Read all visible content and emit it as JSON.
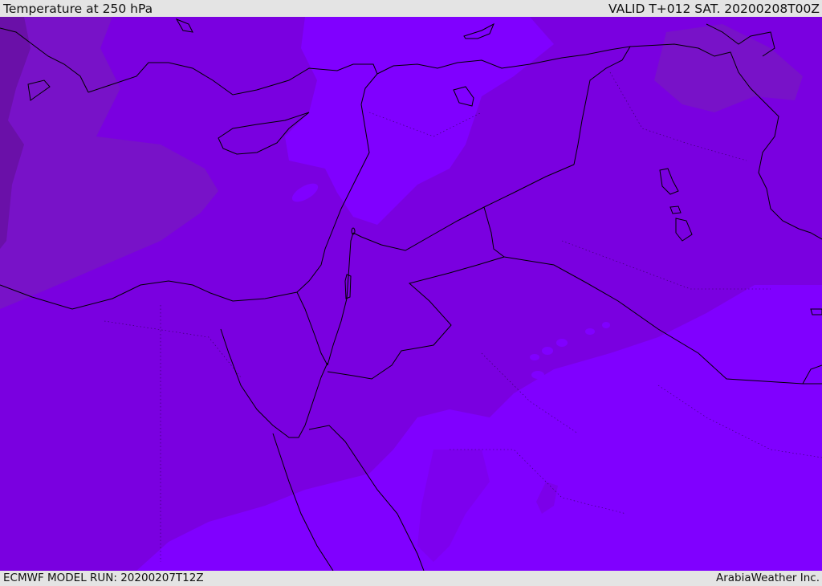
{
  "header": {
    "title": "Temperature at 250 hPa",
    "valid": "VALID T+012 SAT. 20200208T00Z"
  },
  "footer": {
    "model_run": "ECMWF MODEL RUN: 20200207T12Z",
    "credit": "ArabiaWeather Inc."
  },
  "map": {
    "field": "temperature",
    "level_hpa": 250,
    "colors": {
      "base": "#7a00e0",
      "warm_band": "#8000ff",
      "cool_zone": "#7812c8",
      "coldest": "#6a10a8",
      "coastline": "#000000"
    }
  }
}
